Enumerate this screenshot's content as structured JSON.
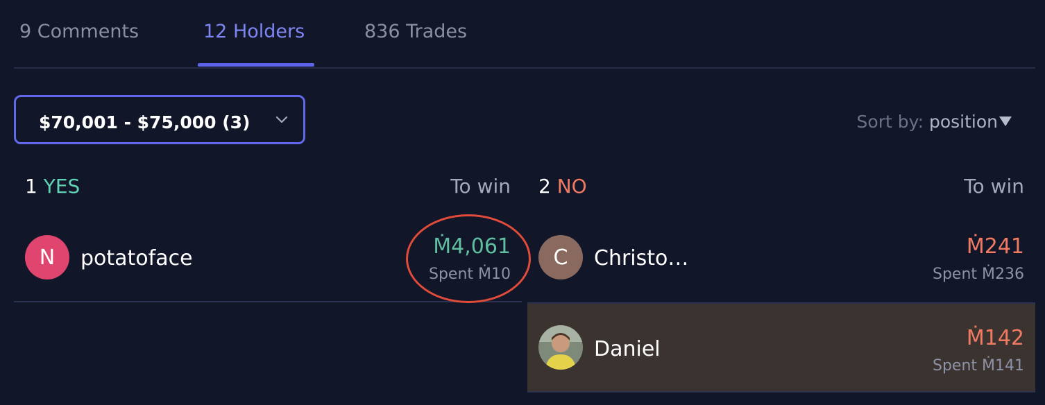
{
  "tabs": [
    {
      "label": "9 Comments"
    },
    {
      "label": "12 Holders"
    },
    {
      "label": "836 Trades"
    }
  ],
  "filter": {
    "selected": "$70,001 - $75,000 (3)"
  },
  "sort": {
    "prefix": "Sort by:",
    "value": "position"
  },
  "yes_column": {
    "count": "1",
    "label": "YES",
    "to_win_label": "To win"
  },
  "no_column": {
    "count": "2",
    "label": "NO",
    "to_win_label": "To win"
  },
  "yes_holders": [
    {
      "initial": "N",
      "name": "potatoface",
      "to_win": "Ṁ4,061",
      "spent": "Spent Ṁ10",
      "avatar_color": "#e0456f"
    }
  ],
  "no_holders": [
    {
      "initial": "C",
      "name": "Christo…",
      "to_win": "Ṁ241",
      "spent": "Spent Ṁ236",
      "avatar_color": "#8a6a5e"
    },
    {
      "name": "Daniel",
      "to_win": "Ṁ142",
      "spent": "Spent Ṁ141",
      "avatar": "photo-avatar",
      "highlighted": true
    }
  ],
  "colors": {
    "accent": "#6268ea",
    "yes": "#5fd3b3",
    "no": "#f07a62",
    "annotation": "#e04b3a"
  }
}
